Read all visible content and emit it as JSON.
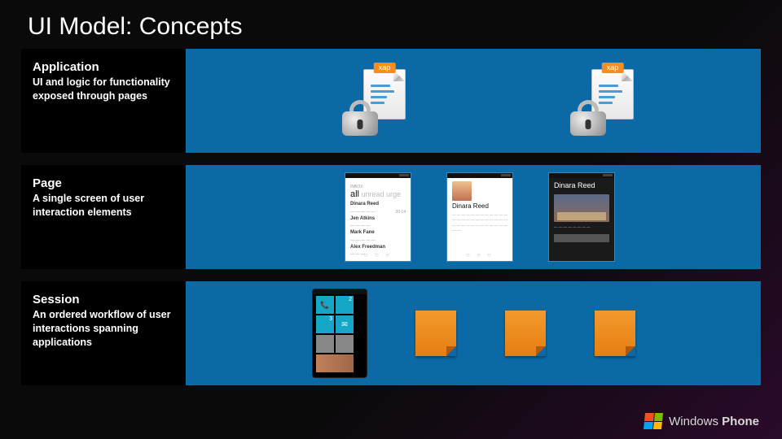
{
  "title": "UI Model: Concepts",
  "rows": [
    {
      "heading": "Application",
      "desc": "UI and logic for functionality exposed through pages",
      "xap_label": "xap"
    },
    {
      "heading": "Page",
      "desc": "A single screen of user interaction elements",
      "thumb1": {
        "tab": "all",
        "rest": " unread urge",
        "names": [
          "Dinara Reed",
          "Jen Atkins",
          "Mark Fane",
          "Alex Freedman"
        ]
      },
      "thumb2": {
        "name": "Dinara Reed"
      },
      "thumb3": {
        "name": "Dinara Reed"
      }
    },
    {
      "heading": "Session",
      "desc": "An ordered workflow of user interactions spanning applications"
    }
  ],
  "footer": {
    "brand1": "Windows",
    "brand2": "Phone"
  }
}
